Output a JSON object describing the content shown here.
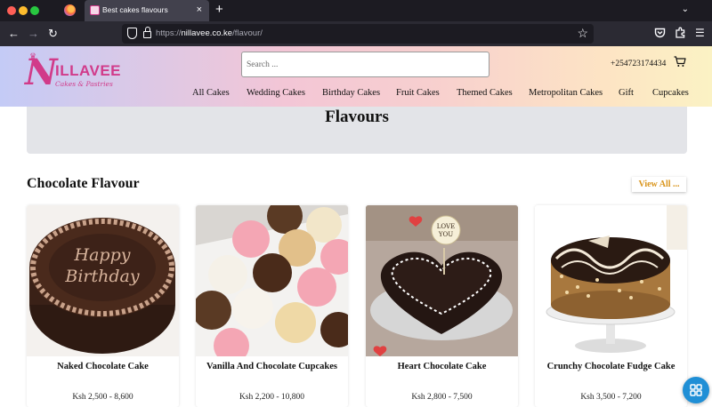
{
  "browser": {
    "tab_title": "Best cakes flavours",
    "tab_close": "×",
    "new_tab": "+",
    "url_scheme": "https://",
    "url_host": "nillavee.co.ke",
    "url_path": "/flavour/",
    "icons": [
      "firefox-icon",
      "back-icon",
      "forward-icon",
      "reload-icon",
      "shield-icon",
      "lock-icon",
      "bookmark-star-icon",
      "pocket-icon",
      "extensions-icon",
      "menu-icon"
    ]
  },
  "header": {
    "logo_letter": "N",
    "logo_word": "ILLAVEE",
    "logo_sub": "Cakes & Pastries",
    "search_placeholder": "Search ...",
    "phone": "+254723174434",
    "nav": [
      "All Cakes",
      "Wedding Cakes",
      "Birthday Cakes",
      "Fruit Cakes",
      "Themed Cakes",
      "Metropolitan Cakes",
      "Gift",
      "Cupcakes"
    ],
    "brand_color": "#d13b8a"
  },
  "hero": {
    "title": "Flavours"
  },
  "section": {
    "title": "Chocolate Flavour",
    "view_all": "View All ...",
    "view_all_color": "#d9941a"
  },
  "products": [
    {
      "name": "Naked Chocolate Cake",
      "price": "Ksh 2,500 - 8,600",
      "cake_text": "Happy Birthday"
    },
    {
      "name": "Vanilla And Chocolate Cupcakes",
      "price": "Ksh 2,200 - 10,800"
    },
    {
      "name": "Heart Chocolate Cake",
      "price": "Ksh 2,800 - 7,500",
      "topper_text": "LOVE YOU"
    },
    {
      "name": "Crunchy Chocolate Fudge Cake",
      "price": "Ksh 3,500 - 7,200"
    }
  ]
}
